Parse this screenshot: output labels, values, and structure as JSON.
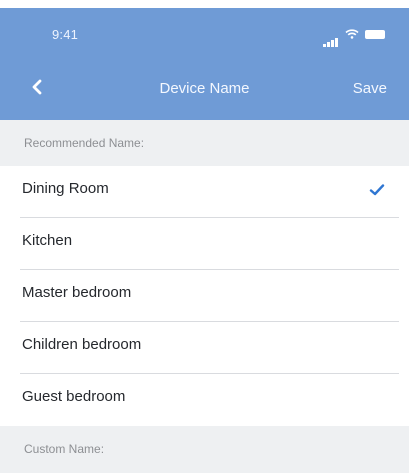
{
  "status_bar": {
    "time": "9:41",
    "icons": [
      "signal-icon",
      "wifi-icon",
      "battery-icon"
    ]
  },
  "nav": {
    "back_icon": "chevron-left-icon",
    "title": "Device Name",
    "save_label": "Save"
  },
  "recommended": {
    "header": "Recommended Name:",
    "selected": "Dining Room",
    "items": [
      {
        "label": "Dining Room",
        "selected": true
      },
      {
        "label": "Kitchen",
        "selected": false
      },
      {
        "label": "Master bedroom",
        "selected": false
      },
      {
        "label": "Children bedroom",
        "selected": false
      },
      {
        "label": "Guest bedroom",
        "selected": false
      }
    ]
  },
  "custom": {
    "header": "Custom Name:"
  },
  "colors": {
    "header_background": "#6f9bd6",
    "accent": "#2f76d2",
    "section_background": "#eef0f2"
  }
}
